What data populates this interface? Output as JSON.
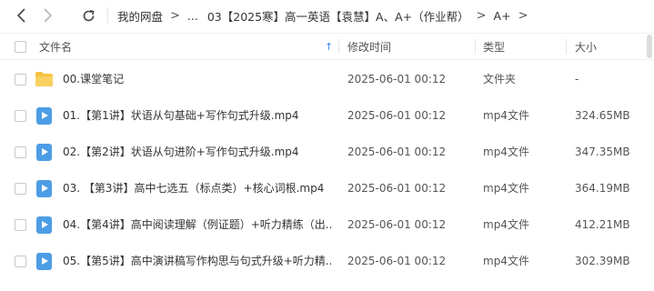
{
  "toolbar": {
    "back_icon": "chevron-left-icon",
    "forward_icon": "chevron-right-icon",
    "refresh_icon": "refresh-icon"
  },
  "breadcrumb": {
    "root": "我的网盘",
    "ellipsis": "...",
    "folder": "03【2025寒】高一英语【袁慧】A、A+（作业帮）",
    "current": "A+"
  },
  "table": {
    "headers": {
      "name": "文件名",
      "sort_indicator": "↑",
      "modified": "修改时间",
      "type": "类型",
      "size": "大小"
    },
    "rows": [
      {
        "kind": "folder",
        "name": "00.课堂笔记",
        "modified": "2025-06-01 00:12",
        "type": "文件夹",
        "size": "-"
      },
      {
        "kind": "video",
        "name": "01.【第1讲】状语从句基础+写作句式升级.mp4",
        "modified": "2025-06-01 00:12",
        "type": "mp4文件",
        "size": "324.65MB"
      },
      {
        "kind": "video",
        "name": "02.【第2讲】状语从句进阶+写作句式升级.mp4",
        "modified": "2025-06-01 00:12",
        "type": "mp4文件",
        "size": "347.35MB"
      },
      {
        "kind": "video",
        "name": "03. 【第3讲】高中七选五（标点类）+核心词根.mp4",
        "modified": "2025-06-01 00:12",
        "type": "mp4文件",
        "size": "364.19MB"
      },
      {
        "kind": "video",
        "name": "04.【第4讲】高中阅读理解（例证题）+听力精练（出...",
        "modified": "2025-06-01 00:12",
        "type": "mp4文件",
        "size": "412.21MB"
      },
      {
        "kind": "video",
        "name": "05.【第5讲】高中演讲稿写作构思与句式升级+听力精...",
        "modified": "2025-06-01 00:12",
        "type": "mp4文件",
        "size": "302.39MB"
      }
    ]
  },
  "colors": {
    "accent": "#3a86e8",
    "folder": "#f7c341",
    "video": "#4d9de6"
  }
}
